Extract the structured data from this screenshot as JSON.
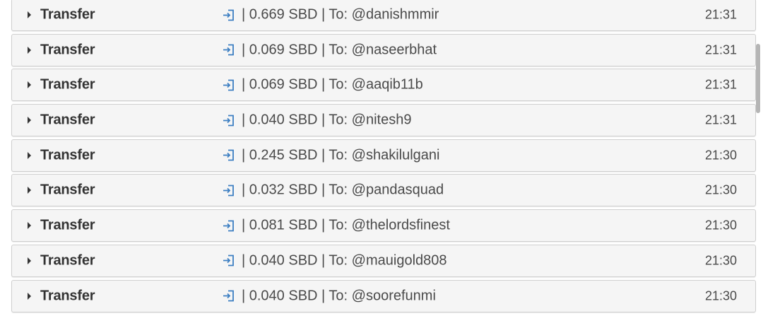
{
  "colors": {
    "row_background": "#f5f5f5",
    "row_border": "#cfcfcf",
    "text": "#4a4a4a",
    "title_text": "#333333",
    "icon_accent": "#3c7fc2",
    "scrollbar": "#b5b5b5"
  },
  "icons": {
    "expand": "caret-right-icon",
    "operation": "sign-in-icon"
  },
  "transactions": [
    {
      "type": "Transfer",
      "detail": "| 0.669 SBD | To: @danishmmir",
      "time": "21:31"
    },
    {
      "type": "Transfer",
      "detail": "| 0.069 SBD | To: @naseerbhat",
      "time": "21:31"
    },
    {
      "type": "Transfer",
      "detail": "| 0.069 SBD | To: @aaqib11b",
      "time": "21:31"
    },
    {
      "type": "Transfer",
      "detail": "| 0.040 SBD | To: @nitesh9",
      "time": "21:31"
    },
    {
      "type": "Transfer",
      "detail": "| 0.245 SBD | To: @shakilulgani",
      "time": "21:30"
    },
    {
      "type": "Transfer",
      "detail": "| 0.032 SBD | To: @pandasquad",
      "time": "21:30"
    },
    {
      "type": "Transfer",
      "detail": "| 0.081 SBD | To: @thelordsfinest",
      "time": "21:30"
    },
    {
      "type": "Transfer",
      "detail": "| 0.040 SBD | To: @mauigold808",
      "time": "21:30"
    },
    {
      "type": "Transfer",
      "detail": "| 0.040 SBD | To: @soorefunmi",
      "time": "21:30"
    }
  ]
}
